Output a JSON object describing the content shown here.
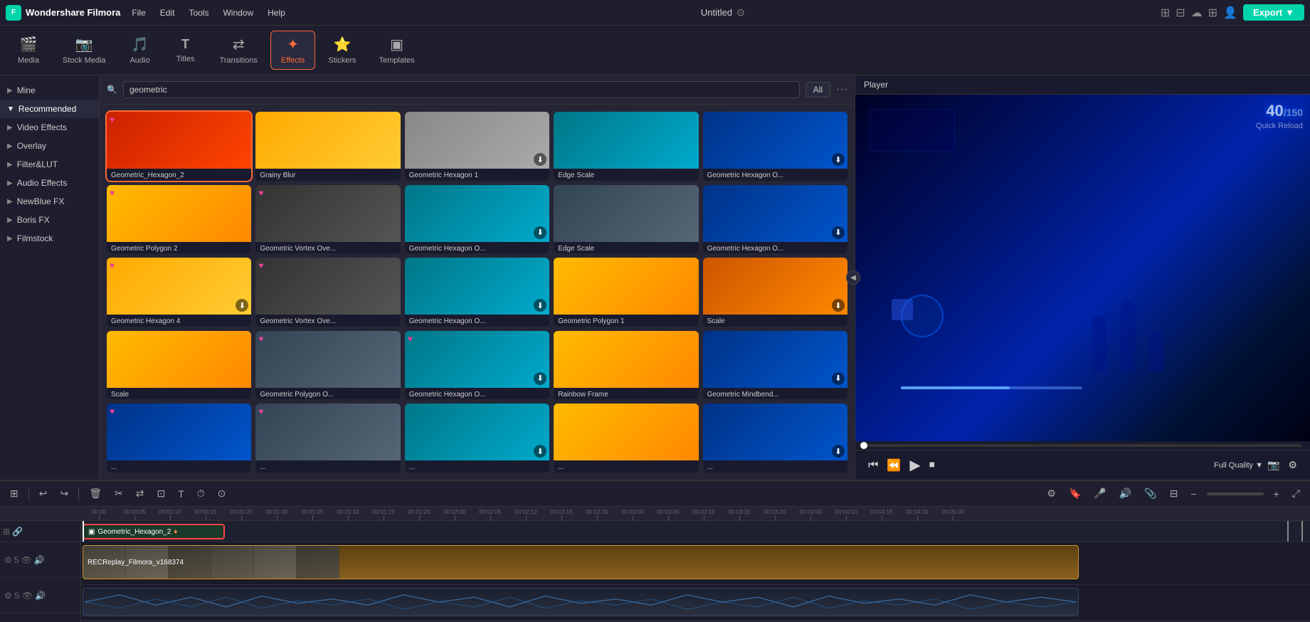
{
  "app": {
    "name": "Wondershare Filmora",
    "title": "Untitled",
    "export_label": "Export"
  },
  "menu": {
    "items": [
      "File",
      "Edit",
      "Tools",
      "Window",
      "Help"
    ]
  },
  "toolbar": {
    "items": [
      {
        "id": "media",
        "label": "Media",
        "icon": "🎬",
        "active": false
      },
      {
        "id": "stock-media",
        "label": "Stock Media",
        "icon": "📷",
        "active": false
      },
      {
        "id": "audio",
        "label": "Audio",
        "icon": "🎵",
        "active": false
      },
      {
        "id": "titles",
        "label": "Titles",
        "icon": "T",
        "active": false
      },
      {
        "id": "transitions",
        "label": "Transitions",
        "icon": "↔",
        "active": false
      },
      {
        "id": "effects",
        "label": "Effects",
        "icon": "✦",
        "active": true
      },
      {
        "id": "stickers",
        "label": "Stickers",
        "icon": "⭐",
        "active": false
      },
      {
        "id": "templates",
        "label": "Templates",
        "icon": "▣",
        "active": false
      }
    ]
  },
  "sidebar": {
    "items": [
      {
        "id": "mine",
        "label": "Mine",
        "active": false
      },
      {
        "id": "recommended",
        "label": "Recommended",
        "active": true
      },
      {
        "id": "video-effects",
        "label": "Video Effects",
        "active": false
      },
      {
        "id": "overlay",
        "label": "Overlay",
        "active": false
      },
      {
        "id": "filter-lut",
        "label": "Filter&LUT",
        "active": false
      },
      {
        "id": "audio-effects",
        "label": "Audio Effects",
        "active": false
      },
      {
        "id": "newblue-fx",
        "label": "NewBlue FX",
        "active": false
      },
      {
        "id": "boris-fx",
        "label": "Boris FX",
        "active": false
      },
      {
        "id": "filmstock",
        "label": "Filmstock",
        "active": false
      }
    ]
  },
  "search": {
    "placeholder": "geometric",
    "value": "geometric",
    "filter": "All"
  },
  "effects": [
    {
      "id": 1,
      "name": "Geometric_Hexagon_2",
      "thumb_class": "thumb-red",
      "heart": true,
      "download": false
    },
    {
      "id": 2,
      "name": "Grainy Blur",
      "thumb_class": "thumb-yellow",
      "heart": false,
      "download": false
    },
    {
      "id": 3,
      "name": "Geometric Hexagon 1",
      "thumb_class": "thumb-gray",
      "heart": false,
      "download": true
    },
    {
      "id": 4,
      "name": "Edge Scale",
      "thumb_class": "thumb-teal",
      "heart": false,
      "download": false
    },
    {
      "id": 5,
      "name": "Geometric Hexagon O...",
      "thumb_class": "thumb-blue",
      "heart": false,
      "download": true
    },
    {
      "id": 6,
      "name": "Geometric Polygon 2",
      "thumb_class": "thumb-flower",
      "heart": true,
      "download": false
    },
    {
      "id": 7,
      "name": "Geometric Vortex Ove...",
      "thumb_class": "thumb-darkgray",
      "heart": true,
      "download": false
    },
    {
      "id": 8,
      "name": "Geometric Hexagon O...",
      "thumb_class": "thumb-teal",
      "heart": false,
      "download": true
    },
    {
      "id": 9,
      "name": "Edge Scale",
      "thumb_class": "thumb-lighthouse",
      "heart": false,
      "download": false
    },
    {
      "id": 10,
      "name": "Geometric Hexagon O...",
      "thumb_class": "thumb-blue",
      "heart": false,
      "download": true
    },
    {
      "id": 11,
      "name": "Geometric Hexagon 4",
      "thumb_class": "thumb-yellow",
      "heart": true,
      "download": true
    },
    {
      "id": 12,
      "name": "Geometric Vortex Ove...",
      "thumb_class": "thumb-darkgray",
      "heart": true,
      "download": false
    },
    {
      "id": 13,
      "name": "Geometric Hexagon O...",
      "thumb_class": "thumb-teal",
      "heart": false,
      "download": true
    },
    {
      "id": 14,
      "name": "Geometric Polygon 1",
      "thumb_class": "thumb-flower",
      "heart": false,
      "download": false
    },
    {
      "id": 15,
      "name": "Scale",
      "thumb_class": "thumb-orange",
      "heart": false,
      "download": true
    },
    {
      "id": 16,
      "name": "Scale",
      "thumb_class": "thumb-flower",
      "heart": false,
      "download": false
    },
    {
      "id": 17,
      "name": "Geometric Polygon O...",
      "thumb_class": "thumb-lighthouse",
      "heart": true,
      "download": false
    },
    {
      "id": 18,
      "name": "Geometric Hexagon O...",
      "thumb_class": "thumb-teal",
      "heart": false,
      "download": true
    },
    {
      "id": 19,
      "name": "Rainbow Frame",
      "thumb_class": "thumb-flower",
      "heart": false,
      "download": false
    },
    {
      "id": 20,
      "name": "Geometric Mindbend...",
      "thumb_class": "thumb-blue",
      "heart": false,
      "download": true
    },
    {
      "id": 21,
      "name": "...",
      "thumb_class": "thumb-blue",
      "heart": true,
      "download": false
    },
    {
      "id": 22,
      "name": "...",
      "thumb_class": "thumb-lighthouse",
      "heart": true,
      "download": false
    },
    {
      "id": 23,
      "name": "...",
      "thumb_class": "thumb-teal",
      "heart": false,
      "download": true
    },
    {
      "id": 24,
      "name": "...",
      "thumb_class": "thumb-flower",
      "heart": false,
      "download": false
    },
    {
      "id": 25,
      "name": "...",
      "thumb_class": "thumb-blue",
      "heart": false,
      "download": true
    }
  ],
  "player": {
    "label": "Player",
    "quality": "Full Quality",
    "progress": 0
  },
  "timeline": {
    "clips": [
      {
        "id": "effect-clip",
        "name": "Geometric_Hexagon_2",
        "type": "effect"
      },
      {
        "id": "video-clip",
        "name": "RECReplay_Filmora_v168374",
        "type": "video"
      }
    ],
    "timecodes": [
      "00:00",
      "00:00:05",
      "00:00:10",
      "00:00:15",
      "00:00:20",
      "00:01:00",
      "00:01:05",
      "00:01:10",
      "00:01:15",
      "00:01:20",
      "00:02:00",
      "00:02:05",
      "00:02:10",
      "00:02:15",
      "00:02:20",
      "00:03:00",
      "00:03:05",
      "00:03:10",
      "00:03:15",
      "00:03:20",
      "00:04:00",
      "00:04:05",
      "00:04:10",
      "00:04:15",
      "00:04:20",
      "00:05:00"
    ]
  }
}
